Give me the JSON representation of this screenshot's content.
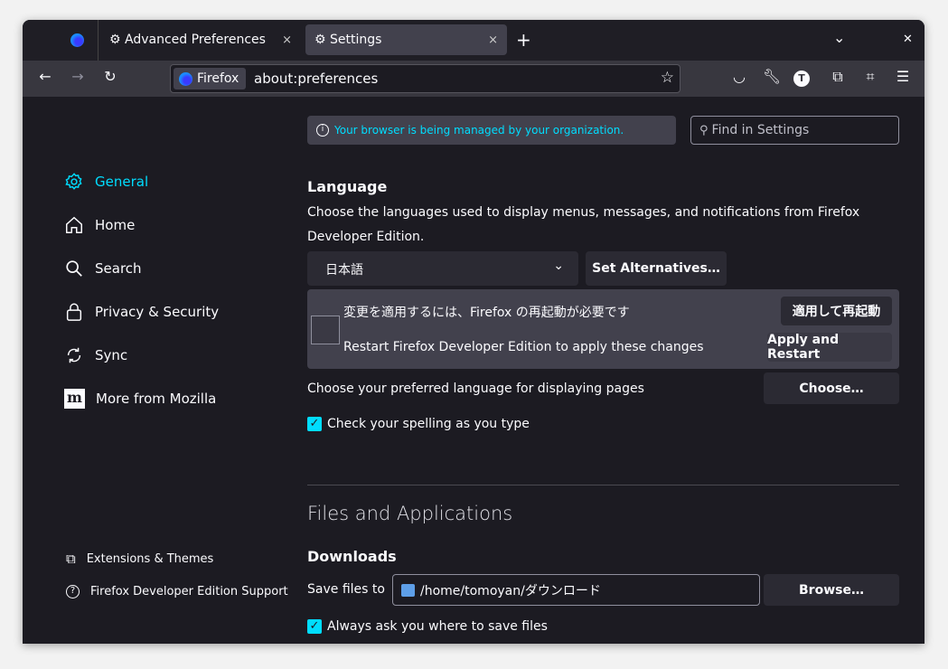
{
  "tabs": [
    {
      "label": "Advanced Preferences",
      "close": "×"
    },
    {
      "label": "Settings",
      "close": "×"
    }
  ],
  "new_tab": "+",
  "list_tabs": "⌄",
  "window_close": "✕",
  "urlbar": {
    "identity": "Firefox",
    "url": "about:preferences"
  },
  "notice": "Your browser is being managed by your organization.",
  "search": {
    "placeholder": "Find in Settings"
  },
  "sidebar": {
    "items": [
      {
        "label": "General",
        "icon": "gear-icon"
      },
      {
        "label": "Home",
        "icon": "home-icon"
      },
      {
        "label": "Search",
        "icon": "search-icon"
      },
      {
        "label": "Privacy & Security",
        "icon": "lock-icon"
      },
      {
        "label": "Sync",
        "icon": "sync-icon"
      },
      {
        "label": "More from Mozilla",
        "icon": "mozilla-icon"
      }
    ],
    "footer": [
      {
        "label": "Extensions & Themes",
        "icon": "puzzle-icon"
      },
      {
        "label": "Firefox Developer Edition Support",
        "icon": "help-icon"
      }
    ]
  },
  "language": {
    "title": "Language",
    "desc": "Choose the languages used to display menus, messages, and notifications from Firefox Developer Edition.",
    "selected": "日本語",
    "set_alt": "Set Alternatives…",
    "restart_ja": "変更を適用するには、Firefox の再起動が必要です",
    "restart_ja_btn": "適用して再起動",
    "restart_en": "Restart Firefox Developer Edition to apply these changes",
    "restart_en_btn": "Apply and Restart",
    "pages_label": "Choose your preferred language for displaying pages",
    "choose": "Choose…",
    "spell": "Check your spelling as you type"
  },
  "files": {
    "title": "Files and Applications",
    "downloads": "Downloads",
    "save_label": "Save files to",
    "path": "/home/tomoyan/ダウンロード",
    "browse": "Browse…",
    "always_ask": "Always ask you where to save files"
  },
  "colors": {
    "accent": "#00ddff",
    "bg": "#1c1b22"
  }
}
